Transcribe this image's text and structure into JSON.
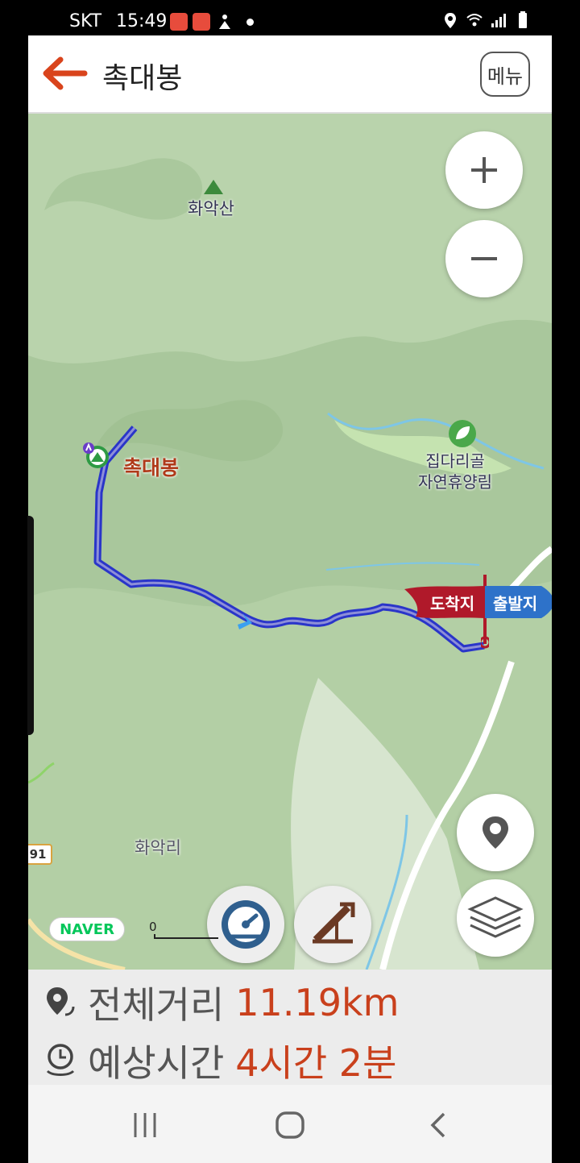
{
  "status_bar": {
    "carrier": "SKT",
    "time": "15:49"
  },
  "header": {
    "back_icon": "arrow-left-icon",
    "title": "촉대봉",
    "menu_label": "메뉴",
    "accent_color": "#d9441c"
  },
  "map": {
    "labels": {
      "peak_hwaaksan": "화악산",
      "summit_chokdaebong": "촉대봉",
      "forest_recreation": "집다리골\n자연휴양림",
      "village": "화악리"
    },
    "road_number": "91",
    "scale_zero": "0",
    "attribution": "NAVER",
    "flags": {
      "end": "도착지",
      "start": "출발지"
    },
    "route_color": "#2a35c9",
    "controls": {
      "zoom_in_icon": "plus-icon",
      "zoom_out_icon": "minus-icon",
      "location_icon": "location-pin-icon",
      "layers_icon": "layers-icon",
      "speedometer_icon": "speedometer-icon",
      "elevation_icon": "elevation-profile-icon"
    }
  },
  "route_info": {
    "distance_label": "전체거리",
    "distance_value": "11.19km",
    "time_label": "예상시간",
    "time_value": "4시간 2분"
  },
  "nav_bar": {
    "recent_icon": "recent-apps-icon",
    "home_icon": "home-icon",
    "back_icon": "back-chevron-icon"
  }
}
